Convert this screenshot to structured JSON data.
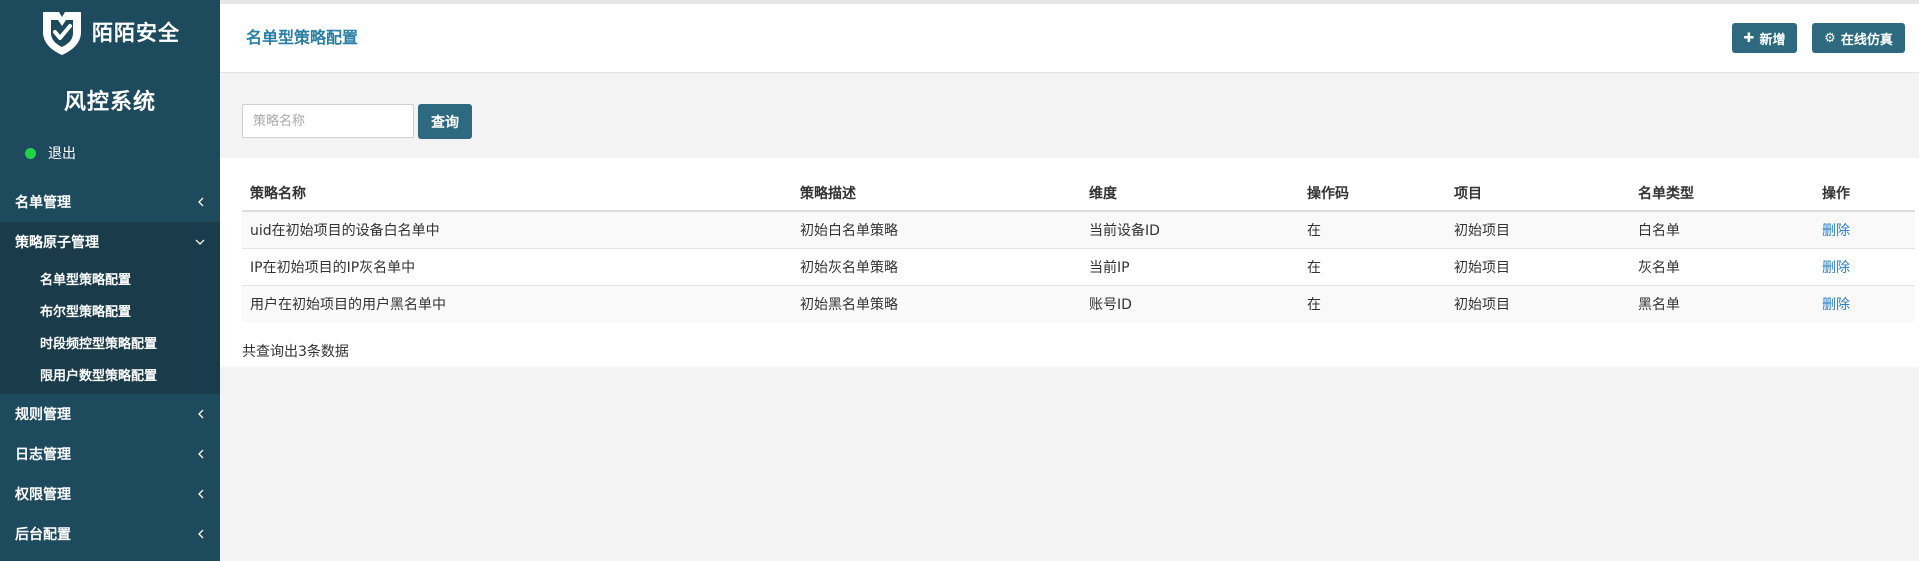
{
  "brand": {
    "name": "陌陌安全",
    "system_title": "风控系统"
  },
  "user": {
    "logout_label": "退出",
    "status_color": "#22d14a"
  },
  "sidebar": {
    "menu": [
      {
        "label": "名单管理"
      },
      {
        "label": "策略原子管理",
        "sub": [
          "名单型策略配置",
          "布尔型策略配置",
          "时段频控型策略配置",
          "限用户数型策略配置"
        ]
      },
      {
        "label": "规则管理"
      },
      {
        "label": "日志管理"
      },
      {
        "label": "权限管理"
      },
      {
        "label": "后台配置"
      }
    ]
  },
  "header": {
    "title": "名单型策略配置",
    "add_label": "新增",
    "simulate_label": "在线仿真"
  },
  "search": {
    "placeholder": "策略名称",
    "value": "",
    "button_label": "查询"
  },
  "table": {
    "columns": [
      "策略名称",
      "策略描述",
      "维度",
      "操作码",
      "项目",
      "名单类型",
      "操作"
    ],
    "rows": [
      [
        "uid在初始项目的设备白名单中",
        "初始白名单策略",
        "当前设备ID",
        "在",
        "初始项目",
        "白名单",
        "删除"
      ],
      [
        "IP在初始项目的IP灰名单中",
        "初始灰名单策略",
        "当前IP",
        "在",
        "初始项目",
        "灰名单",
        "删除"
      ],
      [
        "用户在初始项目的用户黑名单中",
        "初始黑名单策略",
        "账号ID",
        "在",
        "初始项目",
        "黑名单",
        "删除"
      ]
    ],
    "total_text": "共查询出3条数据"
  },
  "colors": {
    "sidebar_bg": "#1e4a5e",
    "accent": "#2e6a7f",
    "title_blue": "#2a7fa5",
    "link_blue": "#2a7fc6"
  },
  "icons": {
    "logo": "shield-check-icon",
    "add": "plus-icon",
    "simulate": "gear-icon",
    "menu_collapsed": "chevron-left-icon",
    "menu_expanded": "chevron-down-icon"
  }
}
